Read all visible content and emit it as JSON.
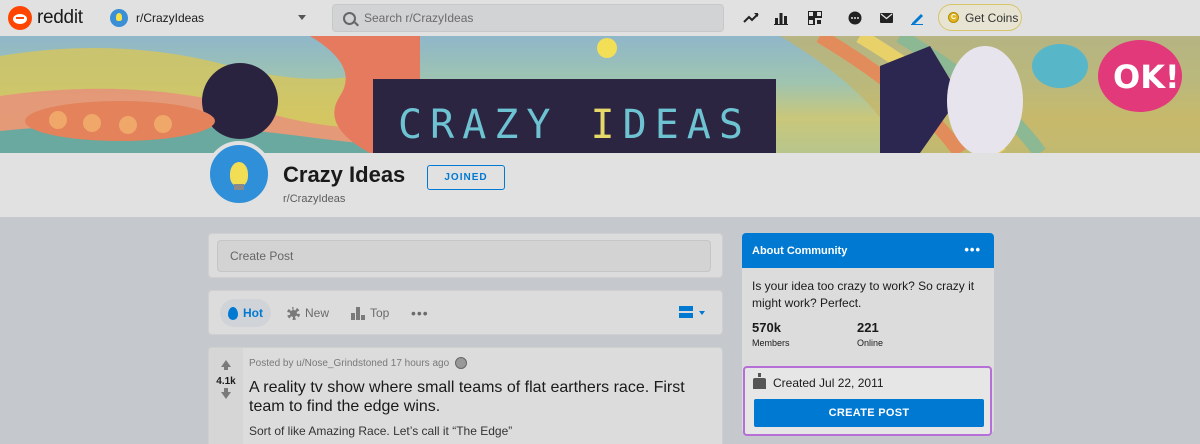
{
  "header": {
    "logo_text": "reddit",
    "community_switcher": "r/CrazyIdeas",
    "search_placeholder": "Search r/CrazyIdeas",
    "icons": [
      "trending-icon",
      "stats-icon",
      "qr-icon",
      "chat-icon",
      "mail-icon",
      "pen-icon"
    ],
    "get_coins": "Get Coins"
  },
  "banner": {
    "title_part1": "CRAZY ",
    "title_part2": "I",
    "title_part3": "DEAS"
  },
  "community": {
    "name": "Crazy Ideas",
    "subreddit": "r/CrazyIdeas",
    "join_label": "JOINED"
  },
  "create_post": {
    "placeholder": "Create Post"
  },
  "sort": {
    "hot": "Hot",
    "new": "New",
    "top": "Top",
    "more": "•••"
  },
  "post": {
    "score": "4.1k",
    "meta": "Posted by u/Nose_Grindstoned 17 hours ago",
    "title": "A reality tv show where small teams of flat earthers race. First team to find the edge wins.",
    "body": "Sort of like Amazing Race. Let’s call it “The Edge”"
  },
  "about": {
    "heading": "About Community",
    "more": "•••",
    "description": "Is your idea too crazy to work? So crazy it might work? Perfect.",
    "members_count": "570k",
    "members_label": "Members",
    "online_count": "221",
    "online_label": "Online",
    "created": "Created Jul 22, 2011",
    "create_post_button": "CREATE POST"
  },
  "colors": {
    "accent": "#0079d3",
    "brand": "#ff4500",
    "highlight_border": "#b56fd6"
  }
}
